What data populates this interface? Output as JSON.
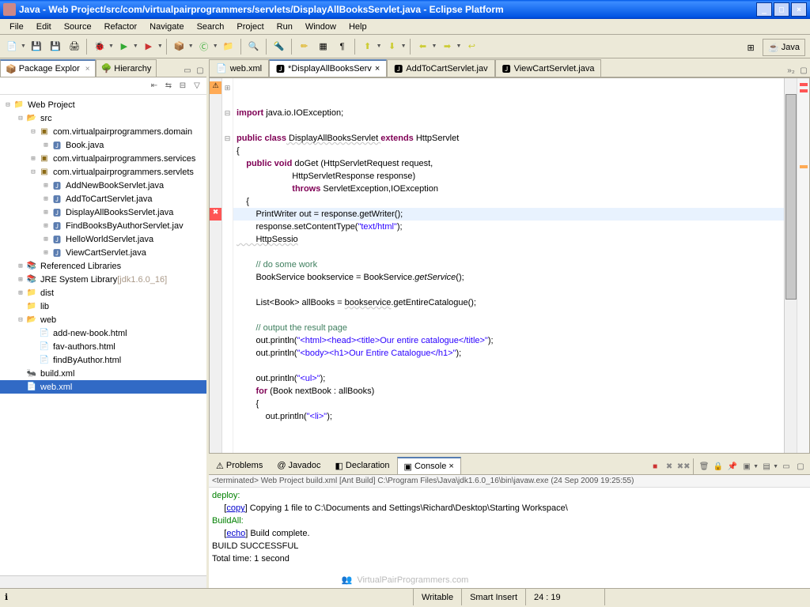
{
  "window": {
    "title": "Java - Web Project/src/com/virtualpairprogrammers/servlets/DisplayAllBooksServlet.java - Eclipse Platform"
  },
  "menubar": [
    "File",
    "Edit",
    "Source",
    "Refactor",
    "Navigate",
    "Search",
    "Project",
    "Run",
    "Window",
    "Help"
  ],
  "perspective": {
    "java_label": "Java"
  },
  "package_explorer": {
    "tab": "Package Explor",
    "hierarchy_tab": "Hierarchy",
    "tree": {
      "project": "Web Project",
      "src": "src",
      "pkg_domain": "com.virtualpairprogrammers.domain",
      "book_java": "Book.java",
      "pkg_services": "com.virtualpairprogrammers.services",
      "pkg_servlets": "com.virtualpairprogrammers.servlets",
      "servlet1": "AddNewBookServlet.java",
      "servlet2": "AddToCartServlet.java",
      "servlet3": "DisplayAllBooksServlet.java",
      "servlet4": "FindBooksByAuthorServlet.jav",
      "servlet5": "HelloWorldServlet.java",
      "servlet6": "ViewCartServlet.java",
      "ref_libs": "Referenced Libraries",
      "jre": "JRE System Library",
      "jre_ver": "[jdk1.6.0_16]",
      "dist": "dist",
      "lib": "lib",
      "web": "web",
      "html1": "add-new-book.html",
      "html2": "fav-authors.html",
      "html3": "findByAuthor.html",
      "build": "build.xml",
      "webxml": "web.xml"
    }
  },
  "editor_tabs": {
    "t1": "web.xml",
    "t2": "*DisplayAllBooksServ",
    "t3": "AddToCartServlet.jav",
    "t4": "ViewCartServlet.java",
    "more": "»₂"
  },
  "code": {
    "l1a": "import",
    "l1b": " java.io.IOException;",
    "l3a": "public",
    "l3b": " class",
    "l3c": " DisplayAllBooksServlet ",
    "l3d": "extends",
    "l3e": " HttpServlet",
    "l4": "{",
    "l5a": "    public",
    "l5b": " void",
    "l5c": " doGet (HttpServletRequest request,",
    "l6": "                       HttpServletResponse response)",
    "l7a": "                       throws",
    "l7b": " ServletException,IOException",
    "l8": "    {",
    "l9": "        PrintWriter out = response.getWriter();",
    "l10a": "        response.setContentType(",
    "l10b": "\"text/html\"",
    "l10c": ");",
    "l11": "        HttpSessio",
    "l13": "        // do some work",
    "l14a": "        BookService bookservice = BookService.",
    "l14b": "getService",
    "l14c": "();",
    "l16a": "        List<Book> allBooks = ",
    "l16b": "bookservice",
    "l16c": ".getEntireCatalogue();",
    "l18": "        // output the result page",
    "l19a": "        out.println(",
    "l19b": "\"<html><head><title>Our entire catalogue</title>\"",
    "l19c": ");",
    "l20a": "        out.println(",
    "l20b": "\"<body><h1>Our Entire Catalogue</h1>\"",
    "l20c": ");",
    "l22a": "        out.println(",
    "l22b": "\"<ul>\"",
    "l22c": ");",
    "l23a": "        for",
    "l23b": " (Book nextBook : allBooks)",
    "l24": "        {",
    "l25a": "            out.println(",
    "l25b": "\"<li>\"",
    "l25c": ");"
  },
  "bottom_tabs": {
    "problems": "Problems",
    "javadoc": "Javadoc",
    "declaration": "Declaration",
    "console": "Console"
  },
  "console": {
    "header": "<terminated> Web Project build.xml [Ant Build] C:\\Program Files\\Java\\jdk1.6.0_16\\bin\\javaw.exe (24 Sep 2009 19:25:55)",
    "l1": "deploy:",
    "l2a": "     [",
    "l2b": "copy",
    "l2c": "] Copying 1 file to C:\\Documents and Settings\\Richard\\Desktop\\Starting Workspace\\",
    "l3": "BuildAll:",
    "l4a": "     [",
    "l4b": "echo",
    "l4c": "] Build complete.",
    "l5": "BUILD SUCCESSFUL",
    "l6": "Total time: 1 second"
  },
  "statusbar": {
    "writable": "Writable",
    "insert": "Smart Insert",
    "cursor": "24 : 19"
  },
  "watermark": "VirtualPairProgrammers.com"
}
